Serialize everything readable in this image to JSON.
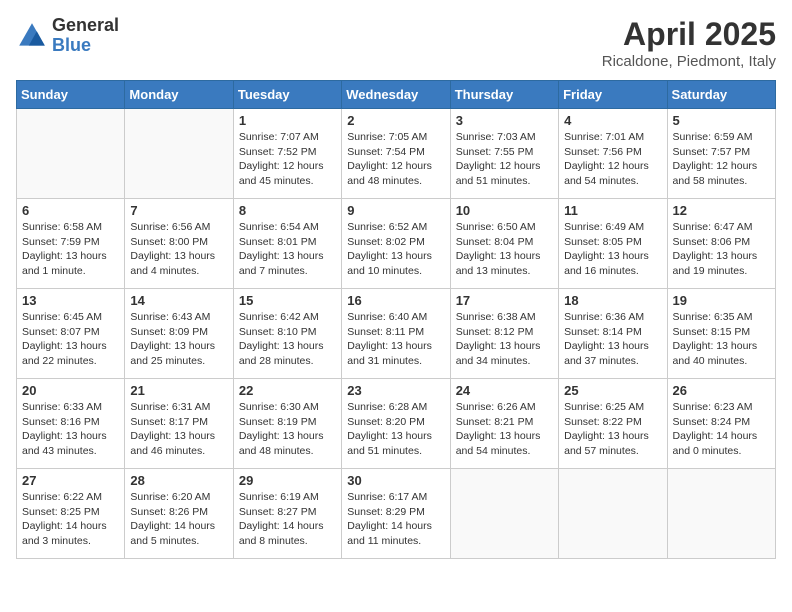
{
  "logo": {
    "general": "General",
    "blue": "Blue"
  },
  "title": "April 2025",
  "location": "Ricaldone, Piedmont, Italy",
  "headers": [
    "Sunday",
    "Monday",
    "Tuesday",
    "Wednesday",
    "Thursday",
    "Friday",
    "Saturday"
  ],
  "weeks": [
    [
      {
        "day": "",
        "info": ""
      },
      {
        "day": "",
        "info": ""
      },
      {
        "day": "1",
        "info": "Sunrise: 7:07 AM\nSunset: 7:52 PM\nDaylight: 12 hours and 45 minutes."
      },
      {
        "day": "2",
        "info": "Sunrise: 7:05 AM\nSunset: 7:54 PM\nDaylight: 12 hours and 48 minutes."
      },
      {
        "day": "3",
        "info": "Sunrise: 7:03 AM\nSunset: 7:55 PM\nDaylight: 12 hours and 51 minutes."
      },
      {
        "day": "4",
        "info": "Sunrise: 7:01 AM\nSunset: 7:56 PM\nDaylight: 12 hours and 54 minutes."
      },
      {
        "day": "5",
        "info": "Sunrise: 6:59 AM\nSunset: 7:57 PM\nDaylight: 12 hours and 58 minutes."
      }
    ],
    [
      {
        "day": "6",
        "info": "Sunrise: 6:58 AM\nSunset: 7:59 PM\nDaylight: 13 hours and 1 minute."
      },
      {
        "day": "7",
        "info": "Sunrise: 6:56 AM\nSunset: 8:00 PM\nDaylight: 13 hours and 4 minutes."
      },
      {
        "day": "8",
        "info": "Sunrise: 6:54 AM\nSunset: 8:01 PM\nDaylight: 13 hours and 7 minutes."
      },
      {
        "day": "9",
        "info": "Sunrise: 6:52 AM\nSunset: 8:02 PM\nDaylight: 13 hours and 10 minutes."
      },
      {
        "day": "10",
        "info": "Sunrise: 6:50 AM\nSunset: 8:04 PM\nDaylight: 13 hours and 13 minutes."
      },
      {
        "day": "11",
        "info": "Sunrise: 6:49 AM\nSunset: 8:05 PM\nDaylight: 13 hours and 16 minutes."
      },
      {
        "day": "12",
        "info": "Sunrise: 6:47 AM\nSunset: 8:06 PM\nDaylight: 13 hours and 19 minutes."
      }
    ],
    [
      {
        "day": "13",
        "info": "Sunrise: 6:45 AM\nSunset: 8:07 PM\nDaylight: 13 hours and 22 minutes."
      },
      {
        "day": "14",
        "info": "Sunrise: 6:43 AM\nSunset: 8:09 PM\nDaylight: 13 hours and 25 minutes."
      },
      {
        "day": "15",
        "info": "Sunrise: 6:42 AM\nSunset: 8:10 PM\nDaylight: 13 hours and 28 minutes."
      },
      {
        "day": "16",
        "info": "Sunrise: 6:40 AM\nSunset: 8:11 PM\nDaylight: 13 hours and 31 minutes."
      },
      {
        "day": "17",
        "info": "Sunrise: 6:38 AM\nSunset: 8:12 PM\nDaylight: 13 hours and 34 minutes."
      },
      {
        "day": "18",
        "info": "Sunrise: 6:36 AM\nSunset: 8:14 PM\nDaylight: 13 hours and 37 minutes."
      },
      {
        "day": "19",
        "info": "Sunrise: 6:35 AM\nSunset: 8:15 PM\nDaylight: 13 hours and 40 minutes."
      }
    ],
    [
      {
        "day": "20",
        "info": "Sunrise: 6:33 AM\nSunset: 8:16 PM\nDaylight: 13 hours and 43 minutes."
      },
      {
        "day": "21",
        "info": "Sunrise: 6:31 AM\nSunset: 8:17 PM\nDaylight: 13 hours and 46 minutes."
      },
      {
        "day": "22",
        "info": "Sunrise: 6:30 AM\nSunset: 8:19 PM\nDaylight: 13 hours and 48 minutes."
      },
      {
        "day": "23",
        "info": "Sunrise: 6:28 AM\nSunset: 8:20 PM\nDaylight: 13 hours and 51 minutes."
      },
      {
        "day": "24",
        "info": "Sunrise: 6:26 AM\nSunset: 8:21 PM\nDaylight: 13 hours and 54 minutes."
      },
      {
        "day": "25",
        "info": "Sunrise: 6:25 AM\nSunset: 8:22 PM\nDaylight: 13 hours and 57 minutes."
      },
      {
        "day": "26",
        "info": "Sunrise: 6:23 AM\nSunset: 8:24 PM\nDaylight: 14 hours and 0 minutes."
      }
    ],
    [
      {
        "day": "27",
        "info": "Sunrise: 6:22 AM\nSunset: 8:25 PM\nDaylight: 14 hours and 3 minutes."
      },
      {
        "day": "28",
        "info": "Sunrise: 6:20 AM\nSunset: 8:26 PM\nDaylight: 14 hours and 5 minutes."
      },
      {
        "day": "29",
        "info": "Sunrise: 6:19 AM\nSunset: 8:27 PM\nDaylight: 14 hours and 8 minutes."
      },
      {
        "day": "30",
        "info": "Sunrise: 6:17 AM\nSunset: 8:29 PM\nDaylight: 14 hours and 11 minutes."
      },
      {
        "day": "",
        "info": ""
      },
      {
        "day": "",
        "info": ""
      },
      {
        "day": "",
        "info": ""
      }
    ]
  ]
}
